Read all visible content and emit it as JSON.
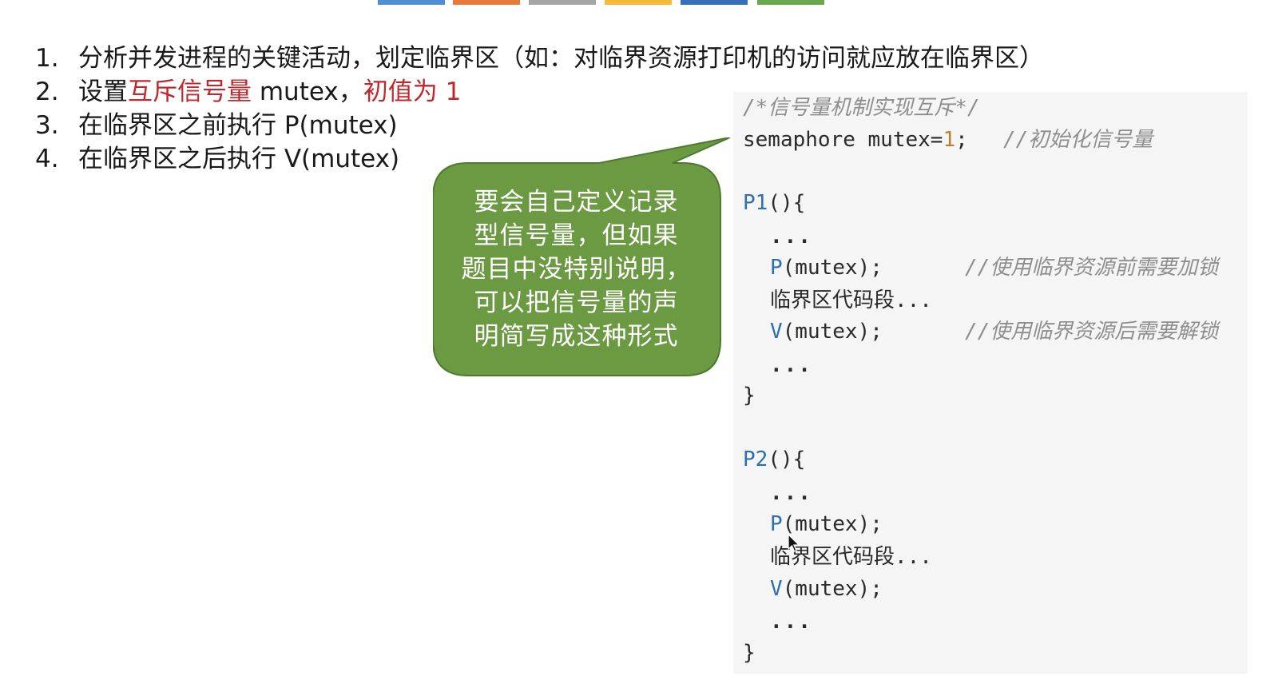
{
  "top_tabs": [
    {
      "color": "#4f8fd1"
    },
    {
      "color": "#e67a3a"
    },
    {
      "color": "#a6a6a6"
    },
    {
      "color": "#f6b93b"
    },
    {
      "color": "#3670b8"
    },
    {
      "color": "#69a84f"
    }
  ],
  "steps": [
    {
      "num": "1.",
      "text": "分析并发进程的关键活动，划定临界区（如：对临界资源打印机的访问就应放在临界区）"
    },
    {
      "num": "2.",
      "pre": "设置",
      "red1": "互斥信号量",
      "mid": " mutex，",
      "red2": "初值为 1"
    },
    {
      "num": "3.",
      "text": "在临界区之前执行 P(mutex)"
    },
    {
      "num": "4.",
      "text": "在临界区之后执行 V(mutex)"
    }
  ],
  "callout": {
    "lines": [
      "要会自己定义记录",
      "型信号量，但如果",
      "题目中没特别说明，",
      "可以把信号量的声",
      "明简写成这种形式"
    ],
    "fill": "#6b9a43"
  },
  "code": {
    "header_comment": "/*信号量机制实现互斥*/",
    "decl_type": "semaphore mutex=",
    "decl_value": "1",
    "decl_end": ";",
    "decl_comment": "//初始化信号量",
    "p1": {
      "name": "P1",
      "open": "(){",
      "dots1": "...",
      "p_kw": "P",
      "p_args": "(mutex);",
      "p_comment": "//使用临界资源前需要加锁",
      "critical": "临界区代码段...",
      "v_kw": "V",
      "v_args": "(mutex);",
      "v_comment": "//使用临界资源后需要解锁",
      "dots2": "...",
      "close": "}"
    },
    "p2": {
      "name": "P2",
      "open": "(){",
      "dots1": "...",
      "p_kw": "P",
      "p_args": "(mutex);",
      "critical": "临界区代码段...",
      "v_kw": "V",
      "v_args": "(mutex);",
      "dots2": "...",
      "close": "}"
    }
  }
}
